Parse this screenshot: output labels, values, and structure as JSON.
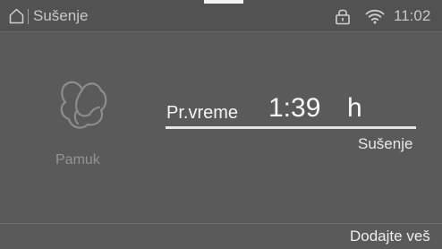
{
  "status_bar": {
    "title": "Sušenje",
    "time": "11:02",
    "icons": [
      "home-icon",
      "lock-icon",
      "wifi-icon"
    ]
  },
  "program": {
    "name": "Pamuk",
    "icon": "cotton-icon"
  },
  "remaining": {
    "label": "Pr.vreme",
    "time": "1:39",
    "unit": "h"
  },
  "progress": {
    "fraction": 1.0
  },
  "phase": {
    "label": "Sušenje"
  },
  "action": {
    "add_laundry": "Dodajte veš"
  },
  "colors": {
    "background": "#5a5a5a",
    "text_primary": "#f4f4f4",
    "text_secondary": "#c8c8c8",
    "text_muted": "#949494"
  }
}
